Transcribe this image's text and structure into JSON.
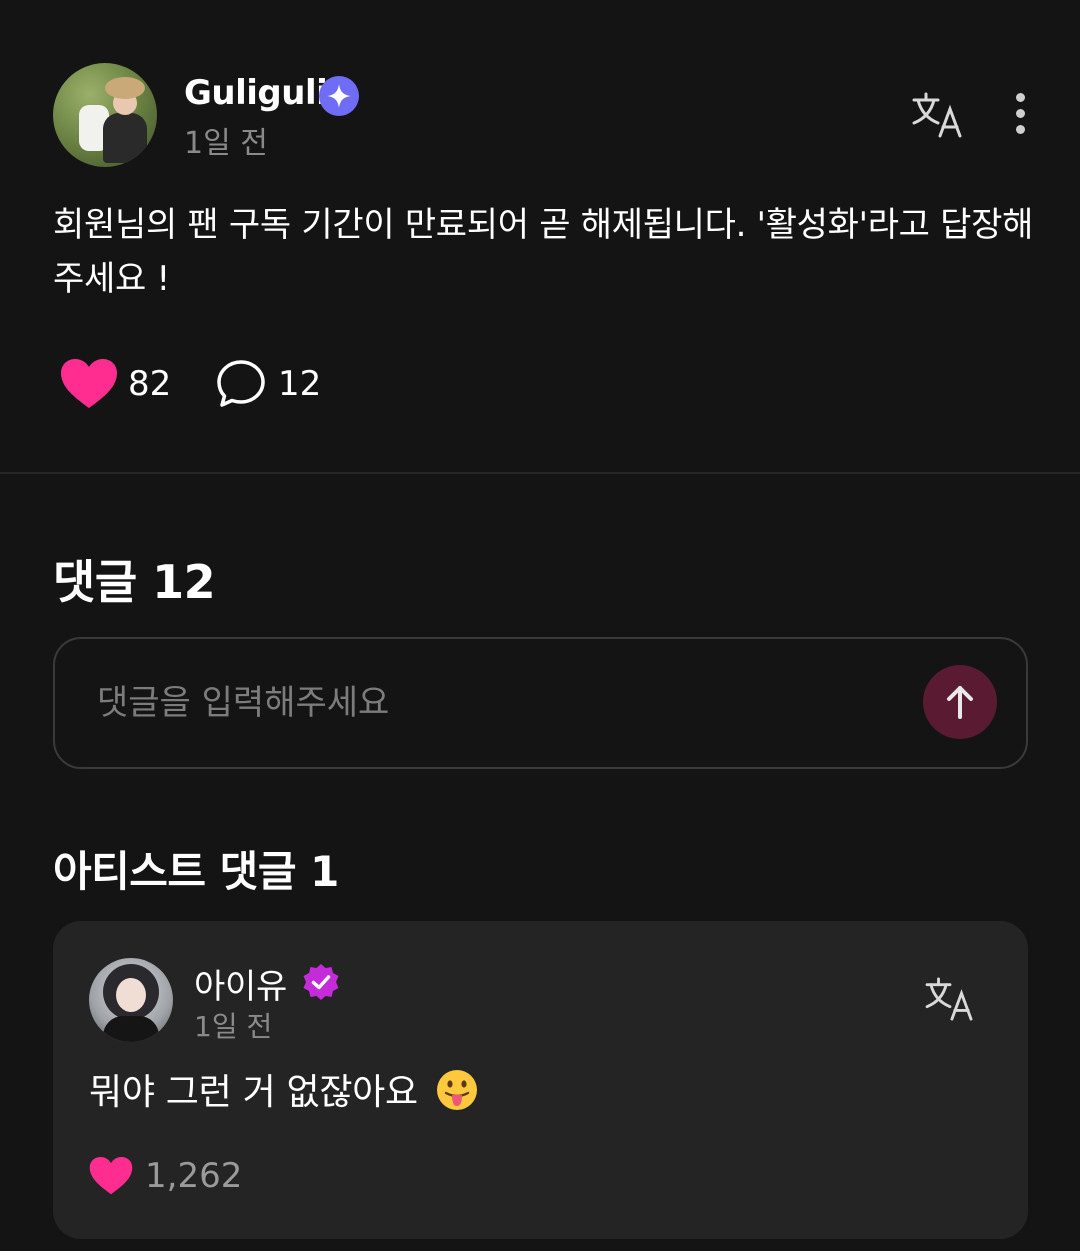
{
  "post": {
    "author_name": "Guliguli",
    "time_ago": "1일 전",
    "text": "회원님의 팬 구독 기간이 만료되어 곧 해제됩니다. '활성화'라고 답장해 주세요 !",
    "like_count": "82",
    "comment_count": "12",
    "icons": {
      "verified": "sparkle-verified-icon",
      "translate": "translate-icon",
      "more": "more-vertical-icon",
      "like": "heart-icon",
      "comment": "speech-bubble-icon"
    }
  },
  "comments": {
    "title": "댓글 12",
    "input_placeholder": "댓글을 입력해주세요",
    "input_value": "",
    "send_icon": "arrow-up-icon"
  },
  "artist_comments": {
    "title": "아티스트 댓글 1",
    "items": [
      {
        "author_name": "아이유",
        "time_ago": "1일 전",
        "text": "뭐야 그런 거 없잖아요",
        "emoji": "😛",
        "like_count": "1,262"
      }
    ]
  },
  "colors": {
    "background": "#141414",
    "card": "#242424",
    "accent_heart": "#ff2d8f",
    "verified_purple": "#6f6cf5",
    "artist_badge": "#c42bd9",
    "send_button": "#5a1a32",
    "muted_text": "#8a8a8a"
  }
}
